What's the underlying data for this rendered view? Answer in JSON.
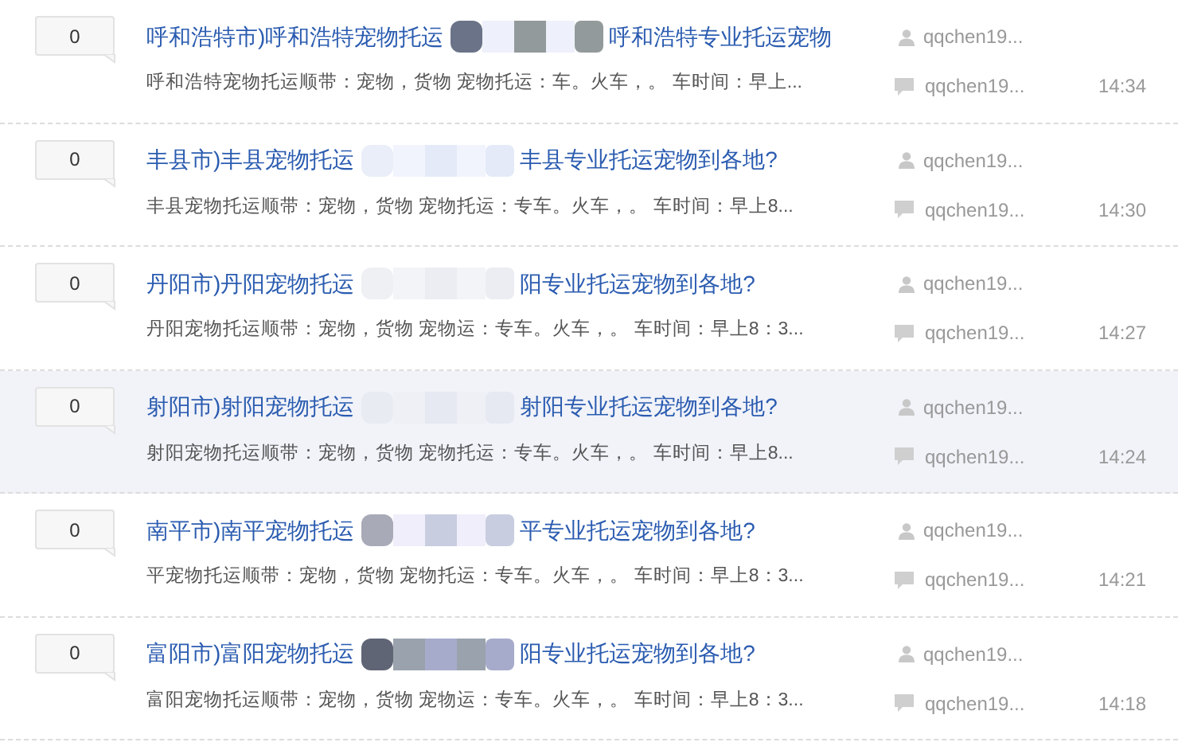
{
  "threads": [
    {
      "count": "0",
      "title_start": "呼和浩特市)呼和浩特宠物托运",
      "title_end": "呼和浩特专业托运宠物",
      "snippet": "呼和浩特宠物托运顺带：宠物，货物 宠物托运：车。火车，。 车时间：早上...",
      "author": "qqchen19...",
      "last_reply_by": "qqchen19...",
      "time": "14:34",
      "highlighted": false
    },
    {
      "count": "0",
      "title_start": "丰县市)丰县宠物托运",
      "title_end": "丰县专业托运宠物到各地?",
      "snippet": "丰县宠物托运顺带：宠物，货物 宠物托运：专车。火车，。 车时间：早上8...",
      "author": "qqchen19...",
      "last_reply_by": "qqchen19...",
      "time": "14:30",
      "highlighted": false
    },
    {
      "count": "0",
      "title_start": "丹阳市)丹阳宠物托运",
      "title_end": "阳专业托运宠物到各地?",
      "snippet": "丹阳宠物托运顺带：宠物，货物 宠物运：专车。火车，。 车时间：早上8：3...",
      "author": "qqchen19...",
      "last_reply_by": "qqchen19...",
      "time": "14:27",
      "highlighted": false
    },
    {
      "count": "0",
      "title_start": "射阳市)射阳宠物托运",
      "title_end": "射阳专业托运宠物到各地?",
      "snippet": "射阳宠物托运顺带：宠物，货物 宠物托运：专车。火车，。 车时间：早上8...",
      "author": "qqchen19...",
      "last_reply_by": "qqchen19...",
      "time": "14:24",
      "highlighted": true
    },
    {
      "count": "0",
      "title_start": "南平市)南平宠物托运",
      "title_end": "平专业托运宠物到各地?",
      "snippet": "平宠物托运顺带：宠物，货物 宠物托运：专车。火车，。 车时间：早上8：3...",
      "author": "qqchen19...",
      "last_reply_by": "qqchen19...",
      "time": "14:21",
      "highlighted": false
    },
    {
      "count": "0",
      "title_start": "富阳市)富阳宠物托运",
      "title_end": "阳专业托运宠物到各地?",
      "snippet": "富阳宠物托运顺带：宠物，货物 宠物运：专车。火车，。 车时间：早上8：3...",
      "author": "qqchen19...",
      "last_reply_by": "qqchen19...",
      "time": "14:18",
      "highlighted": false
    }
  ]
}
